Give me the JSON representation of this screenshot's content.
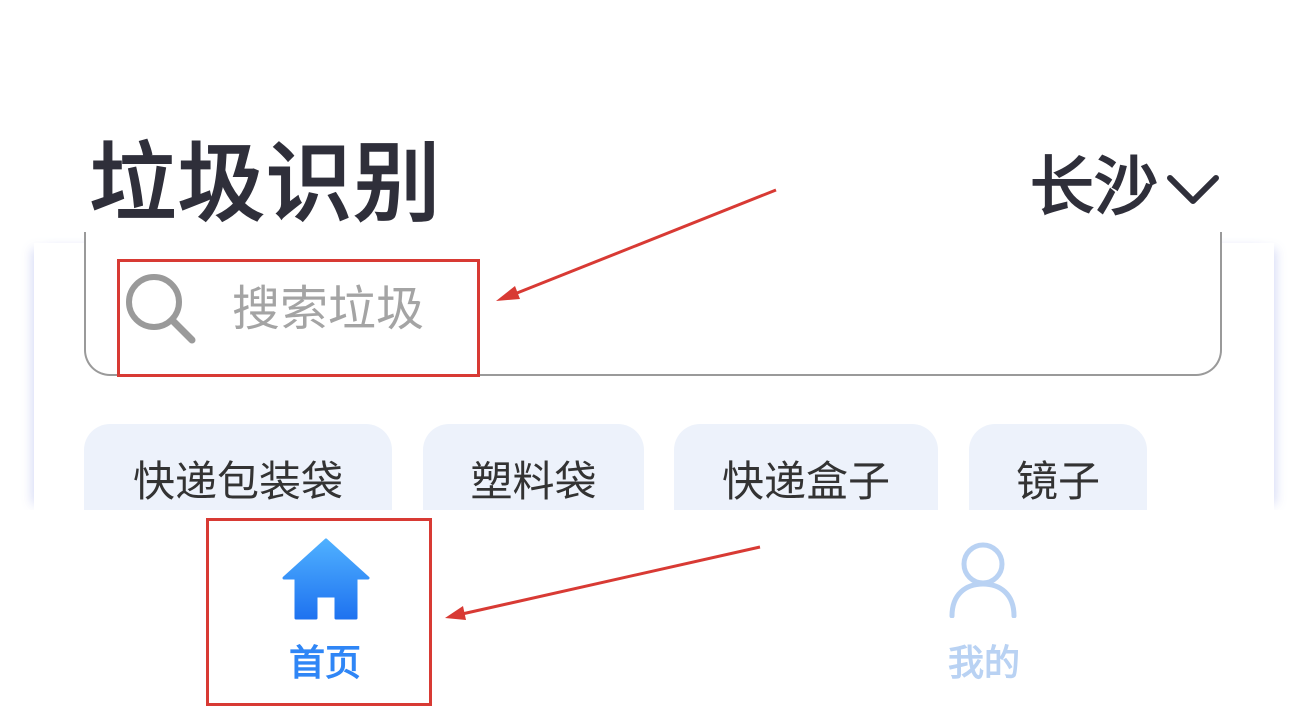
{
  "header": {
    "title": "垃圾识别",
    "city": "长沙"
  },
  "search": {
    "placeholder": "搜索垃圾"
  },
  "quick_tags": [
    {
      "label": "快递包装袋"
    },
    {
      "label": "塑料袋"
    },
    {
      "label": "快递盒子"
    },
    {
      "label": "镜子"
    }
  ],
  "bottom_nav": {
    "items": [
      {
        "label": "首页",
        "icon": "home-icon",
        "active": true
      },
      {
        "label": "我的",
        "icon": "profile-icon",
        "active": false
      }
    ]
  },
  "colors": {
    "accent": "#2f86f6",
    "inactive": "#b9d2f3",
    "chip_bg": "#edf2fb",
    "annotation": "#d83a34"
  }
}
